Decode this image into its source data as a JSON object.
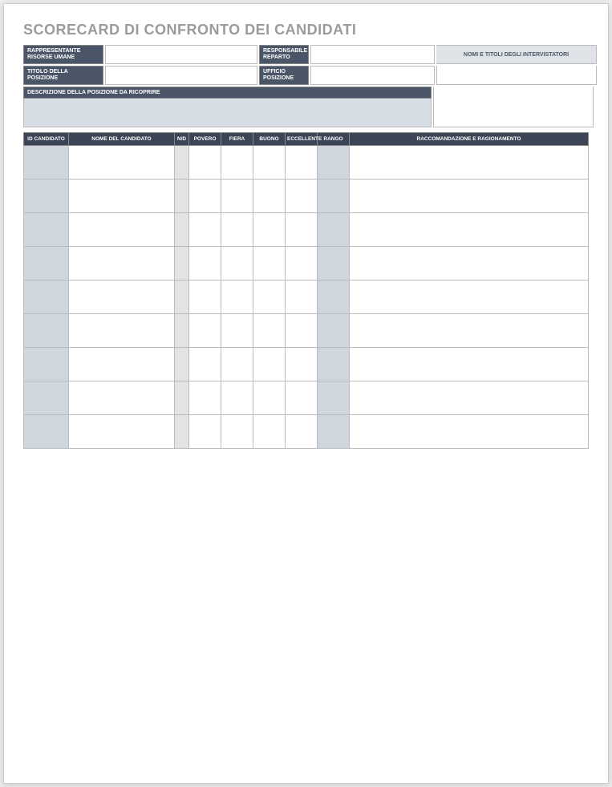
{
  "title": "SCORECARD DI CONFRONTO DEI CANDIDATI",
  "info": {
    "hr_rep_label": "RAPPRESENTANTE RISORSE UMANE",
    "hr_rep_value": "",
    "dept_mgr_label": "RESPONSABILE REPARTO",
    "dept_mgr_value": "",
    "position_title_label": "TITOLO DELLA POSIZIONE",
    "position_title_value": "",
    "position_office_label": "UFFICIO POSIZIONE",
    "position_office_value": "",
    "desc_label": "DESCRIZIONE DELLA POSIZIONE DA RICOPRIRE",
    "desc_value": "",
    "interviewer_header": "NOMI E TITOLI DEGLI INTERVISTATORI",
    "interviewer_value": ""
  },
  "table": {
    "headers": {
      "id": "ID CANDIDATO",
      "name": "NOME DEL CANDIDATO",
      "nd": "N/D",
      "poor": "POVERO",
      "fair": "FIERA",
      "good": "BUONO",
      "excellent": "ECCELLENTE",
      "rank": "RANGO",
      "recc": "RACCOMANDAZIONE E RAGIONAMENTO"
    },
    "rows": [
      {
        "id": "",
        "name": "",
        "nd": "",
        "poor": "",
        "fair": "",
        "good": "",
        "excellent": "",
        "rank": "",
        "recc": ""
      },
      {
        "id": "",
        "name": "",
        "nd": "",
        "poor": "",
        "fair": "",
        "good": "",
        "excellent": "",
        "rank": "",
        "recc": ""
      },
      {
        "id": "",
        "name": "",
        "nd": "",
        "poor": "",
        "fair": "",
        "good": "",
        "excellent": "",
        "rank": "",
        "recc": ""
      },
      {
        "id": "",
        "name": "",
        "nd": "",
        "poor": "",
        "fair": "",
        "good": "",
        "excellent": "",
        "rank": "",
        "recc": ""
      },
      {
        "id": "",
        "name": "",
        "nd": "",
        "poor": "",
        "fair": "",
        "good": "",
        "excellent": "",
        "rank": "",
        "recc": ""
      },
      {
        "id": "",
        "name": "",
        "nd": "",
        "poor": "",
        "fair": "",
        "good": "",
        "excellent": "",
        "rank": "",
        "recc": ""
      },
      {
        "id": "",
        "name": "",
        "nd": "",
        "poor": "",
        "fair": "",
        "good": "",
        "excellent": "",
        "rank": "",
        "recc": ""
      },
      {
        "id": "",
        "name": "",
        "nd": "",
        "poor": "",
        "fair": "",
        "good": "",
        "excellent": "",
        "rank": "",
        "recc": ""
      },
      {
        "id": "",
        "name": "",
        "nd": "",
        "poor": "",
        "fair": "",
        "good": "",
        "excellent": "",
        "rank": "",
        "recc": ""
      }
    ]
  }
}
